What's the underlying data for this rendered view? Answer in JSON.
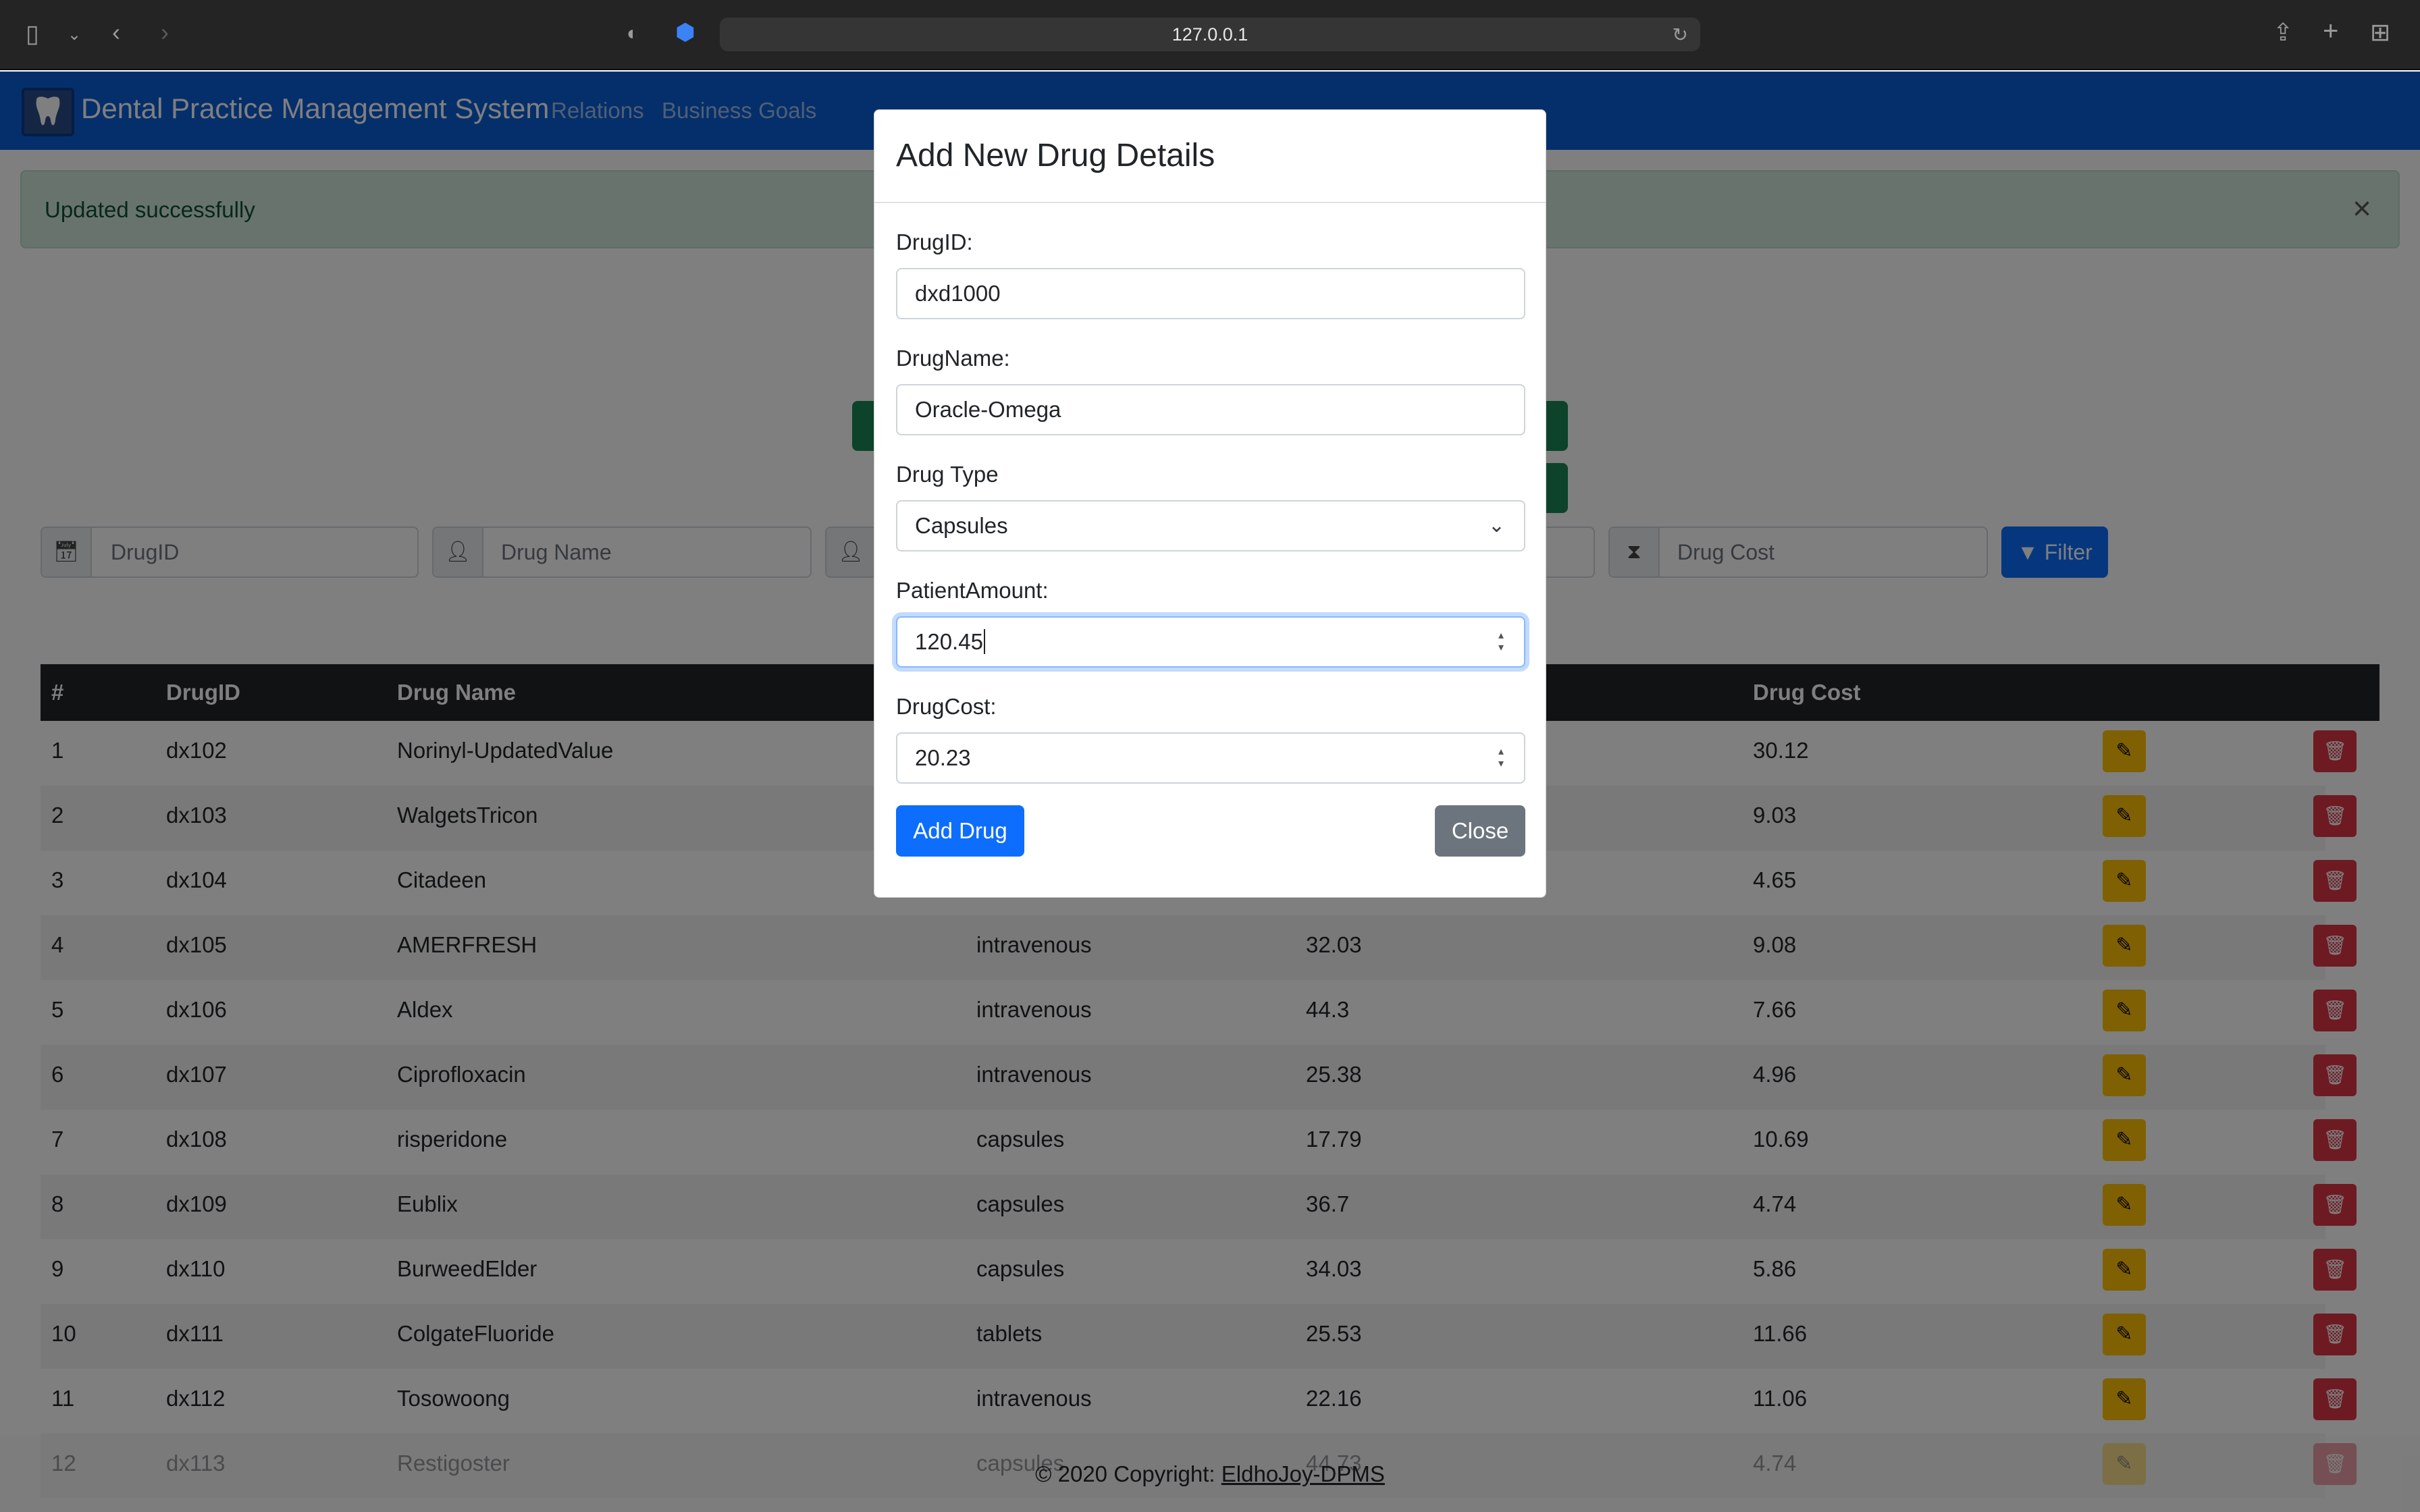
{
  "browser": {
    "url": "127.0.0.1"
  },
  "navbar": {
    "brand": "Dental Practice Management System",
    "links": [
      "Relations",
      "Business Goals"
    ]
  },
  "alert": {
    "message": "Updated successfully",
    "close": "×"
  },
  "filters": {
    "drugid_placeholder": "DrugID",
    "drugname_placeholder": "Drug Name",
    "drugcost_placeholder": "Drug Cost",
    "button": "Filter"
  },
  "table": {
    "headers": [
      "#",
      "DrugID",
      "Drug Name",
      "Drug Cost"
    ],
    "rows": [
      {
        "n": "1",
        "id": "dx102",
        "name": "Norinyl-UpdatedValue",
        "type": "",
        "amount": "",
        "cost": "30.12"
      },
      {
        "n": "2",
        "id": "dx103",
        "name": "WalgetsTricon",
        "type": "",
        "amount": "",
        "cost": "9.03"
      },
      {
        "n": "3",
        "id": "dx104",
        "name": "Citadeen",
        "type": "",
        "amount": "",
        "cost": "4.65"
      },
      {
        "n": "4",
        "id": "dx105",
        "name": "AMERFRESH",
        "type": "intravenous",
        "amount": "32.03",
        "cost": "9.08"
      },
      {
        "n": "5",
        "id": "dx106",
        "name": "Aldex",
        "type": "intravenous",
        "amount": "44.3",
        "cost": "7.66"
      },
      {
        "n": "6",
        "id": "dx107",
        "name": "Ciprofloxacin",
        "type": "intravenous",
        "amount": "25.38",
        "cost": "4.96"
      },
      {
        "n": "7",
        "id": "dx108",
        "name": "risperidone",
        "type": "capsules",
        "amount": "17.79",
        "cost": "10.69"
      },
      {
        "n": "8",
        "id": "dx109",
        "name": "Eublix",
        "type": "capsules",
        "amount": "36.7",
        "cost": "4.74"
      },
      {
        "n": "9",
        "id": "dx110",
        "name": "BurweedElder",
        "type": "capsules",
        "amount": "34.03",
        "cost": "5.86"
      },
      {
        "n": "10",
        "id": "dx111",
        "name": "ColgateFluoride",
        "type": "tablets",
        "amount": "25.53",
        "cost": "11.66"
      },
      {
        "n": "11",
        "id": "dx112",
        "name": "Tosowoong",
        "type": "intravenous",
        "amount": "22.16",
        "cost": "11.06"
      },
      {
        "n": "12",
        "id": "dx113",
        "name": "Restigoster",
        "type": "capsules",
        "amount": "44.73",
        "cost": "4.74"
      }
    ]
  },
  "footer": {
    "text": "© 2020 Copyright: ",
    "link": "EldhoJoy-DPMS"
  },
  "modal": {
    "title": "Add New Drug Details",
    "fields": {
      "drugid_label": "DrugID:",
      "drugid_value": "dxd1000",
      "drugname_label": "DrugName:",
      "drugname_value": "Oracle-Omega",
      "drugtype_label": "Drug Type",
      "drugtype_value": "Capsules",
      "patientamount_label": "PatientAmount:",
      "patientamount_value": "120.45",
      "drugcost_label": "DrugCost:",
      "drugcost_value": "20.23"
    },
    "add_button": "Add Drug",
    "close_button": "Close"
  },
  "colors": {
    "navbar": "#0b5ed7",
    "primary": "#0d6efd",
    "edit": "#ffc107",
    "delete": "#dc3545",
    "alert_bg": "#d1e7dd"
  }
}
